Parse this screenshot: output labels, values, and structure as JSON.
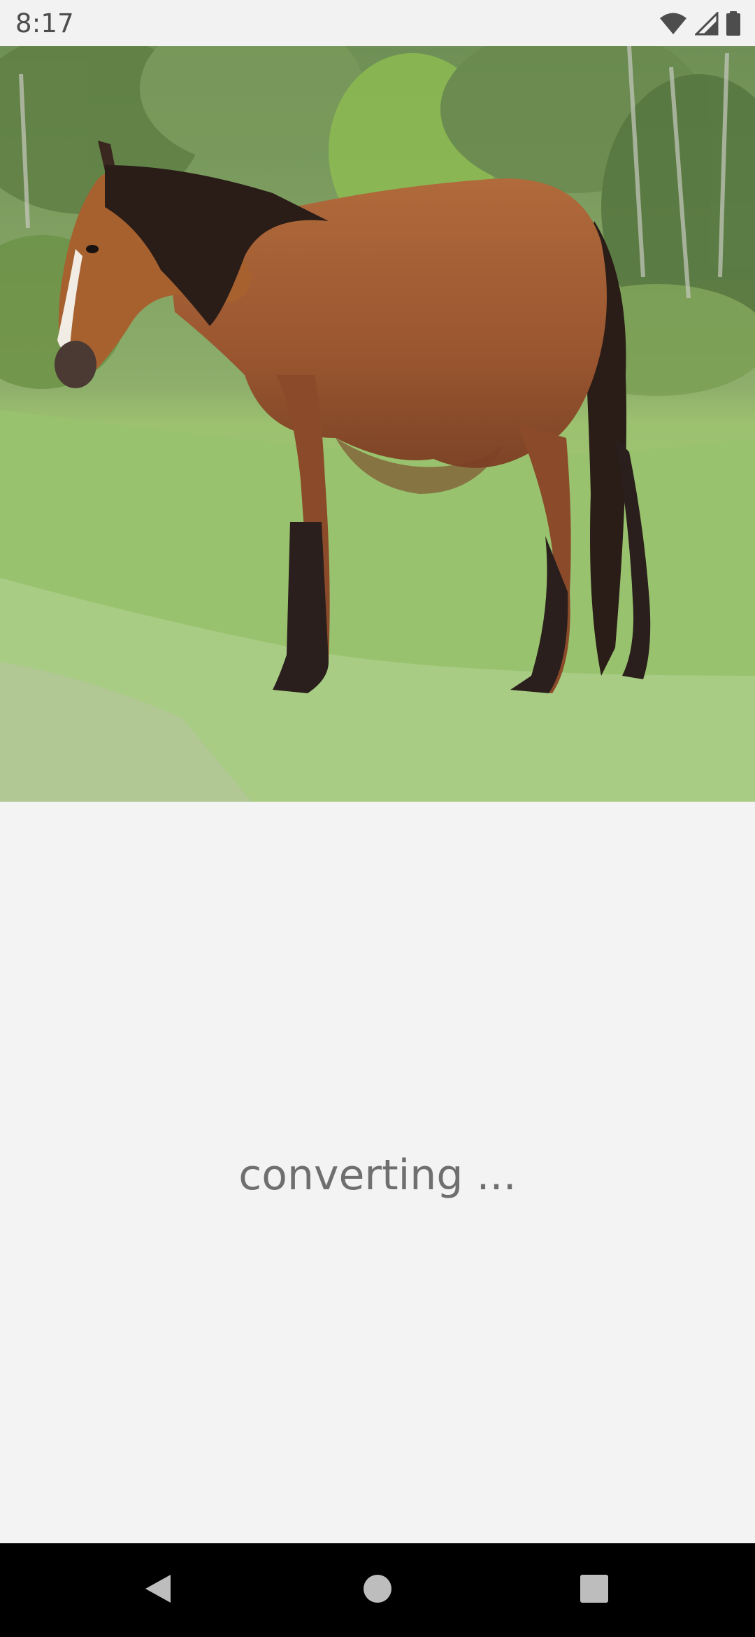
{
  "status_bar": {
    "time": "8:17",
    "icons": [
      "wifi-icon",
      "signal-icon",
      "battery-icon"
    ],
    "icon_color": "#4d4d4d"
  },
  "image": {
    "subject": "horse-photo"
  },
  "main": {
    "status_text": "converting ..."
  },
  "nav_bar": {
    "buttons": [
      "back-icon",
      "home-icon",
      "recents-icon"
    ],
    "button_color": "#bdbdbd"
  },
  "colors": {
    "background": "#f3f3f3",
    "text": "#6f6f6f",
    "nav_background": "#000000"
  }
}
